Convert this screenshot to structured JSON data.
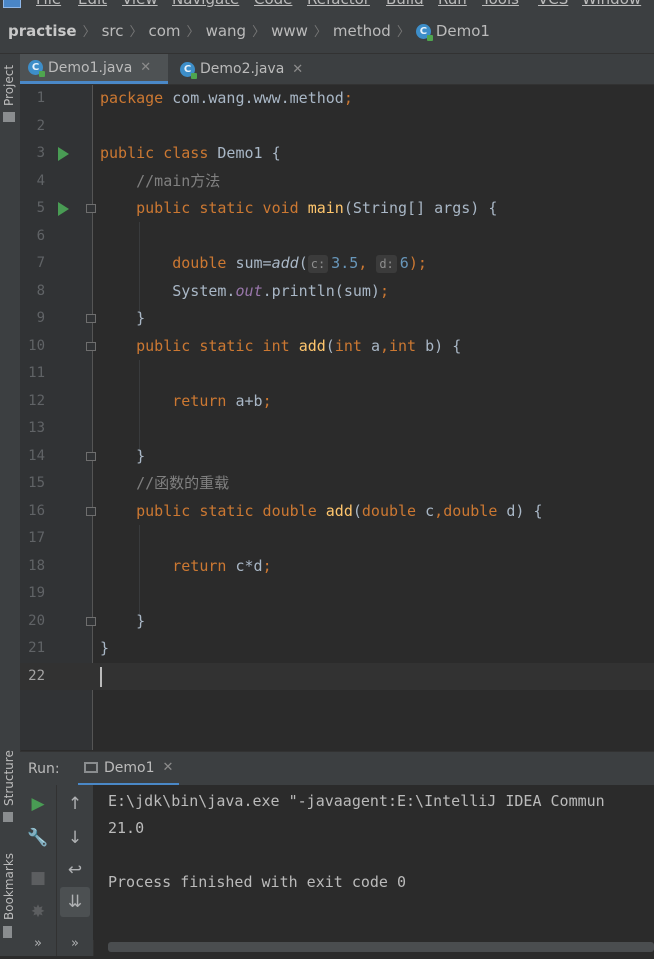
{
  "menubar": {
    "items": [
      "File",
      "Edit",
      "View",
      "Navigate",
      "Code",
      "Refactor",
      "Build",
      "Run",
      "Tools",
      "VCS",
      "Window"
    ]
  },
  "breadcrumb": {
    "items": [
      "practise",
      "src",
      "com",
      "wang",
      "www",
      "method",
      "Demo1"
    ]
  },
  "sidebar": {
    "project_label": "Project",
    "structure_label": "Structure",
    "bookmarks_label": "Bookmarks"
  },
  "tabs": [
    {
      "label": "Demo1.java",
      "active": true
    },
    {
      "label": "Demo2.java",
      "active": false
    }
  ],
  "editor": {
    "line_numbers": [
      "1",
      "2",
      "3",
      "4",
      "5",
      "6",
      "7",
      "8",
      "9",
      "10",
      "11",
      "12",
      "13",
      "14",
      "15",
      "16",
      "17",
      "18",
      "19",
      "20",
      "21",
      "22"
    ],
    "current_line": 22,
    "code": {
      "l1_kw": "package ",
      "l1_rest": "com.wang.www.method",
      "l1_semi": ";",
      "l3_kw": "public class ",
      "l3_rest": "Demo1 {",
      "l4_comment": "    //main方法",
      "l5_kw": "    public static void ",
      "l5_fn": "main",
      "l5_rest": "(String[] args) {",
      "l7_kw": "        double ",
      "l7_var": "sum=",
      "l7_call": "add",
      "l7_paren": "(",
      "l7_hint_c": "c:",
      "l7_num1": "3.5",
      "l7_comma": ", ",
      "l7_hint_d": "d:",
      "l7_num2": "6",
      "l7_end": ");",
      "l8_pre": "        System.",
      "l8_out": "out",
      "l8_rest": ".println(sum)",
      "l8_semi": ";",
      "l9": "    }",
      "l10_kw": "    public static int ",
      "l10_fn": "add",
      "l10_p1": "(",
      "l10_int1": "int ",
      "l10_a": "a",
      "l10_comma": ",",
      "l10_int2": "int ",
      "l10_b": "b) {",
      "l12_kw": "        return ",
      "l12_rest": "a+b",
      "l12_semi": ";",
      "l14": "    }",
      "l15_comment": "    //函数的重载",
      "l16_kw": "    public static double ",
      "l16_fn": "add",
      "l16_p1": "(",
      "l16_d1": "double ",
      "l16_c": "c",
      "l16_comma": ",",
      "l16_d2": "double ",
      "l16_dd": "d) {",
      "l18_kw": "        return ",
      "l18_rest": "c*d",
      "l18_semi": ";",
      "l20": "    }",
      "l21": "}"
    }
  },
  "run_panel": {
    "label": "Run:",
    "tab_label": "Demo1",
    "console_lines": [
      "E:\\jdk\\bin\\java.exe \"-javaagent:E:\\IntelliJ IDEA Commun",
      "21.0",
      "",
      "Process finished with exit code 0"
    ]
  },
  "colors": {
    "keyword": "#cc7832",
    "function": "#ffc66d",
    "number": "#6897bb",
    "comment": "#808080",
    "static_field": "#9876aa",
    "run_green": "#499c54",
    "accent_blue": "#4a88c7"
  }
}
